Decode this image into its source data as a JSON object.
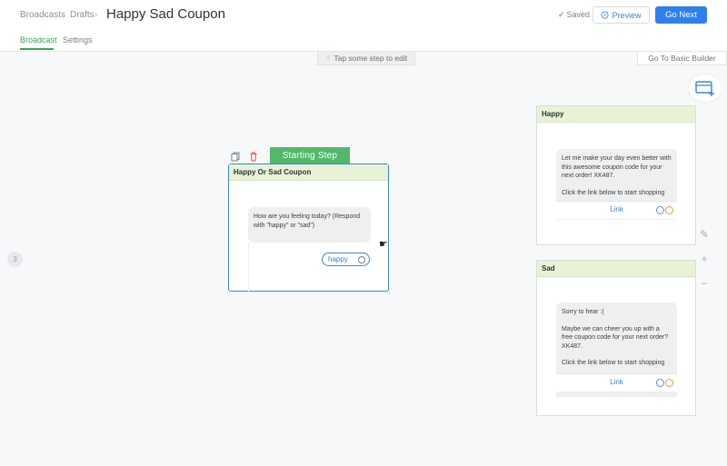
{
  "header": {
    "breadcrumbs": [
      "Broadcasts",
      "Drafts"
    ],
    "title": "Happy Sad Coupon",
    "status": "Saved",
    "preview_label": "Preview",
    "next_label": "Go Next",
    "tabs": [
      {
        "label": "Broadcast",
        "active": true
      },
      {
        "label": "Settings",
        "active": false
      }
    ]
  },
  "canvas": {
    "hint": "Tap some step to edit",
    "basic_builder": "Go To Basic Builder",
    "left_badge": "3",
    "starting_tag": "Starting Step"
  },
  "steps": {
    "start": {
      "title": "Happy Or Sad Coupon",
      "message": "How are you feeling today? (Respond with \"happy\" or \"sad\")",
      "quick_reply": "happy"
    },
    "happy": {
      "title": "Happy",
      "message_line1": "Let me make your day even better with this awesome coupon code for your next order! XK487.",
      "message_line2": "Click the link below to start shopping",
      "link": "Link"
    },
    "sad": {
      "title": "Sad",
      "message_line1": "Sorry to hear :(",
      "message_line2": "Maybe we can cheer you up with a free coupon code for your next order? XK487.",
      "message_line3": "Click the link below to start shopping",
      "link": "Link"
    }
  },
  "colors": {
    "accent_green": "#52b86a",
    "primary_blue": "#2f80ed",
    "card_header": "#e8f3d6"
  },
  "icons": [
    "chevron-right-icon",
    "check-icon",
    "preview-icon",
    "hand-icon",
    "add-step-icon",
    "copy-icon",
    "trash-icon",
    "magic-wand-icon",
    "zoom-in-icon",
    "zoom-out-icon",
    "link-icon",
    "coin-icon",
    "cursor-icon"
  ]
}
